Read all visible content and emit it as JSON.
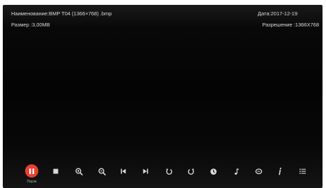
{
  "info": {
    "name_label": "Наименование:",
    "name_value": "BMP T04  (1366×768)  .bmp",
    "size_label": "Размер :",
    "size_value": "3,00MB",
    "date_label": "Дата:",
    "date_value": "2017-12-19",
    "res_label": "Разрешение :",
    "res_value": "1366X768"
  },
  "toolbar": {
    "pause_label": "Пауза",
    "buttons": [
      "pause-icon",
      "stop-icon",
      "zoom-in-icon",
      "zoom-out-icon",
      "previous-icon",
      "next-icon",
      "rotate-left-icon",
      "rotate-right-icon",
      "clock-icon",
      "music-note-icon",
      "subtitle-icon",
      "info-icon",
      "playlist-icon"
    ]
  },
  "colors": {
    "accent": "#e8422f",
    "icon": "#d8d8d8",
    "text": "#d9d9d9",
    "background": "#050505"
  }
}
